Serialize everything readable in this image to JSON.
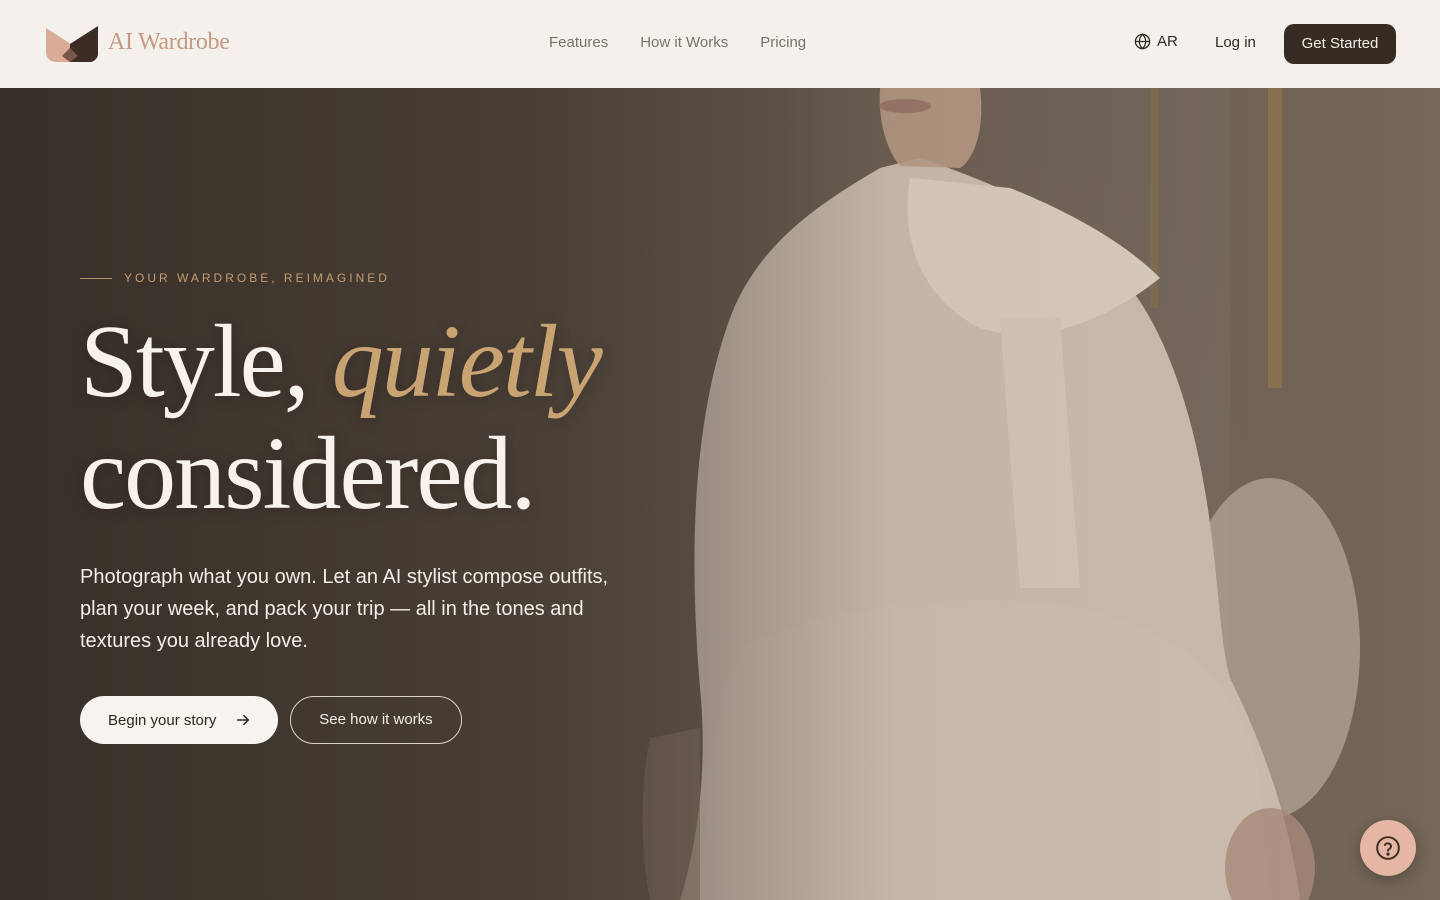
{
  "header": {
    "brand": "AI Wardrobe",
    "nav": [
      "Features",
      "How it Works",
      "Pricing"
    ],
    "language": "AR",
    "login_label": "Log in",
    "cta_label": "Get Started"
  },
  "hero": {
    "eyebrow": "YOUR WARDROBE, REIMAGINED",
    "headline_part1": "Style, ",
    "headline_accent": "quietly",
    "headline_part2": "considered.",
    "subcopy": "Photograph what you own. Let an AI stylist compose outfits, plan your week, and pack your trip — all in the tones and textures you already love.",
    "primary_button": "Begin your story",
    "secondary_button": "See how it works"
  },
  "icons": {
    "logo": "brand-logo-icon",
    "language": "globe-icon",
    "primary_arrow": "arrow-right-icon",
    "help": "question-mark-icon"
  },
  "colors": {
    "header_bg": "#f4f1ed",
    "brand_text": "#c49a85",
    "cta_dark": "#372c24",
    "accent_gold": "#c9a372",
    "help_button": "#e5b6a3"
  }
}
